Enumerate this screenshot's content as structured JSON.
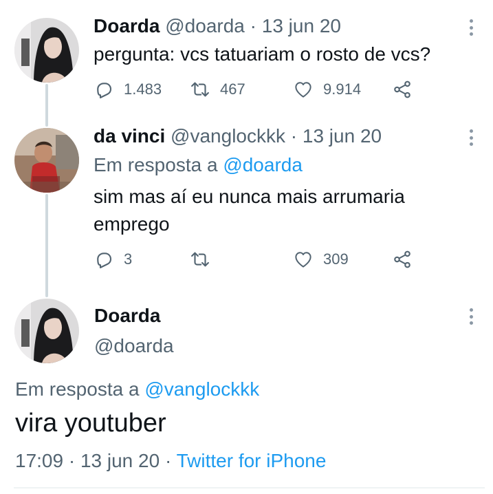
{
  "tweets": [
    {
      "name": "Doarda",
      "handle": "@doarda",
      "separator": "·",
      "date": "13 jun 20",
      "text": "pergunta: vcs tatuariam o rosto de vcs?",
      "replies": "1.483",
      "retweets": "467",
      "likes": "9.914"
    },
    {
      "name": "da vinci",
      "handle": "@vanglockkk",
      "separator": "·",
      "date": "13 jun 20",
      "reply_prefix": "Em resposta a",
      "reply_to": "@doarda",
      "text_line1": "sim mas aí eu nunca mais arrumaria",
      "text_line2": "emprego",
      "replies": "3",
      "retweets": "",
      "likes": "309"
    }
  ],
  "main_tweet": {
    "name": "Doarda",
    "handle": "@doarda",
    "reply_prefix": "Em resposta a",
    "reply_to": "@vanglockkk",
    "text": "vira youtuber",
    "time": "17:09",
    "separator": "·",
    "date": "13 jun 20",
    "source": "Twitter for iPhone"
  },
  "icons": {
    "reply": "reply-icon",
    "retweet": "retweet-icon",
    "like": "heart-icon",
    "share": "share-icon",
    "more": "more-options-icon"
  },
  "colors": {
    "link": "#1d9bf0",
    "secondary_text": "#536471",
    "thread_line": "#cfd9de"
  }
}
